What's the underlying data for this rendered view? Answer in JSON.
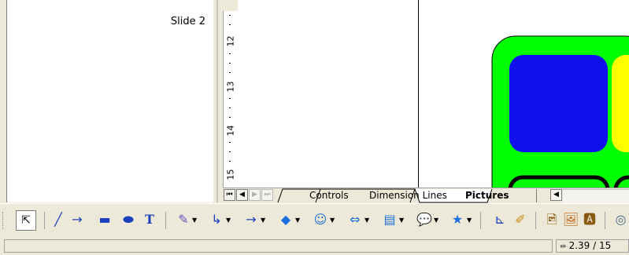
{
  "slide_pane": {
    "slide_label": "Slide 2"
  },
  "ruler": {
    "marks": [
      "12",
      "13",
      "14",
      "15"
    ]
  },
  "tabs": {
    "items": [
      {
        "label": "Controls",
        "active": false
      },
      {
        "label": "Dimension Lines",
        "active": false
      },
      {
        "label": "Pictures",
        "active": true
      }
    ]
  },
  "toolbar": {
    "tools": [
      {
        "name": "select-icon",
        "glyph": "⇱"
      },
      {
        "name": "line-icon",
        "glyph": "╱"
      },
      {
        "name": "arrow-line-icon",
        "glyph": "→"
      },
      {
        "name": "rectangle-icon",
        "glyph": "▬"
      },
      {
        "name": "ellipse-icon",
        "glyph": "⬬"
      },
      {
        "name": "text-icon",
        "glyph": "T"
      },
      {
        "name": "curve-icon",
        "glyph": "✎"
      },
      {
        "name": "connector-icon",
        "glyph": "↳"
      },
      {
        "name": "lines-arrows-icon",
        "glyph": "→"
      },
      {
        "name": "basic-shapes-icon",
        "glyph": "◆"
      },
      {
        "name": "symbol-shapes-icon",
        "glyph": "☺"
      },
      {
        "name": "block-arrows-icon",
        "glyph": "⇔"
      },
      {
        "name": "flowchart-icon",
        "glyph": "▤"
      },
      {
        "name": "callouts-icon",
        "glyph": "💬"
      },
      {
        "name": "stars-icon",
        "glyph": "★"
      },
      {
        "name": "points-icon",
        "glyph": "⊾"
      },
      {
        "name": "glue-points-icon",
        "glyph": "✐"
      },
      {
        "name": "from-file-icon",
        "glyph": "🖻"
      },
      {
        "name": "gallery-icon",
        "glyph": "🖼"
      },
      {
        "name": "fontwork-icon",
        "glyph": "🅰"
      },
      {
        "name": "extrusion-icon",
        "glyph": "◎"
      }
    ]
  },
  "statusbar": {
    "position": "2.39 / 15"
  },
  "colors": {
    "green": "#00ff00",
    "blue": "#1010ee",
    "yellow": "#ffff00",
    "black": "#000000"
  }
}
